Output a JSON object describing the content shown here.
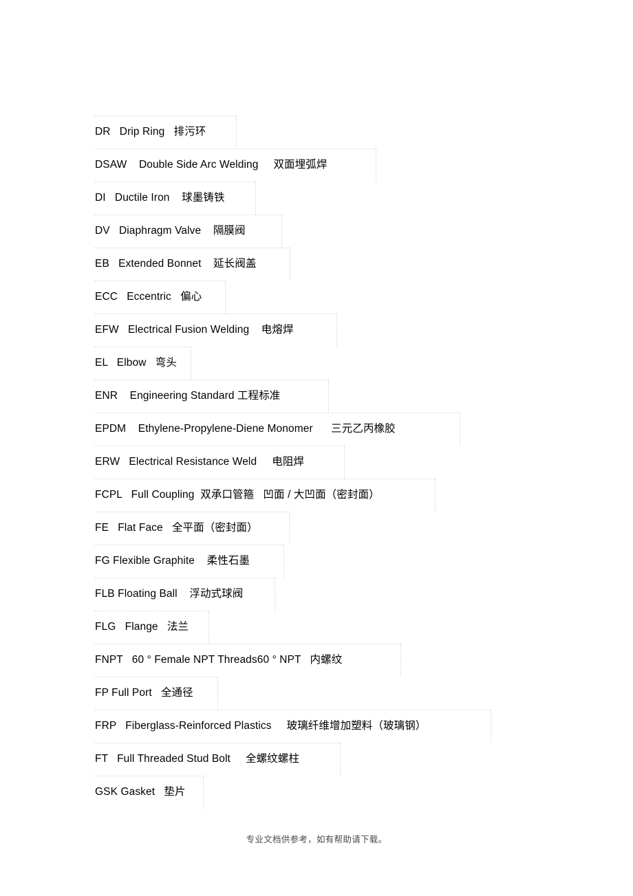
{
  "document": {
    "title": "Piping & Valve Abbreviations Glossary",
    "background_color": "#ffffff",
    "text_color": "#000000",
    "border_color": "#d8d8d8"
  },
  "glossary": {
    "rows": [
      {
        "text": "DR   Drip Ring   排污环",
        "rule_width": 206
      },
      {
        "text": "DSAW    Double Side Arc Welding     双面埋弧焊",
        "rule_width": 409
      },
      {
        "text": "DI   Ductile Iron    球墨铸铁",
        "rule_width": 234
      },
      {
        "text": "DV   Diaphragm Valve    隔膜阀",
        "rule_width": 272
      },
      {
        "text": "EB   Extended Bonnet    延长阀盖",
        "rule_width": 284
      },
      {
        "text": "ECC   Eccentric   偏心",
        "rule_width": 190
      },
      {
        "text": "EFW   Electrical Fusion Welding    电熔焊",
        "rule_width": 352
      },
      {
        "text": "EL   Elbow   弯头",
        "rule_width": 140
      },
      {
        "text": "ENR    Engineering Standard 工程标准",
        "rule_width": 340
      },
      {
        "text": "EPDM    Ethylene-Propylene-Diene Monomer      三元乙丙橡胶",
        "rule_width": 531
      },
      {
        "text": "ERW   Electrical Resistance Weld     电阻焊",
        "rule_width": 363
      },
      {
        "text": "FCPL   Full Coupling  双承口管箍   凹面 / 大凹面（密封面）",
        "rule_width": 495
      },
      {
        "text": "FE   Flat Face   全平面（密封面）",
        "rule_width": 283
      },
      {
        "text": "FG Flexible Graphite    柔性石墨",
        "rule_width": 275
      },
      {
        "text": "FLB Floating Ball    浮动式球阀",
        "rule_width": 262
      },
      {
        "text": "FLG   Flange   法兰",
        "rule_width": 166
      },
      {
        "text": "FNPT   60 ° Female NPT Threads60 ° NPT   内螺纹",
        "rule_width": 445
      },
      {
        "text": "FP Full Port   全通径",
        "rule_width": 179
      },
      {
        "text": "FRP   Fiberglass-Reinforced Plastics     玻璃纤维增加塑料（玻璃钢）",
        "rule_width": 576
      },
      {
        "text": "FT   Full Threaded Stud Bolt     全螺纹螺柱",
        "rule_width": 357
      },
      {
        "text": "GSK Gasket   垫片",
        "rule_width": 158
      }
    ]
  },
  "footer": {
    "note": "专业文档供参考，如有帮助请下载。"
  }
}
